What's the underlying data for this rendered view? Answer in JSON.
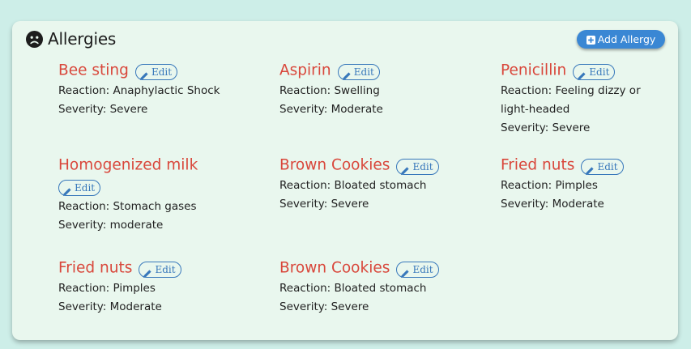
{
  "header": {
    "title": "Allergies",
    "add_label": "Add Allergy"
  },
  "edit_label": "Edit",
  "items": [
    {
      "name": "Bee sting",
      "reaction": "Reaction: Anaphylactic Shock",
      "severity": "Severity: Severe"
    },
    {
      "name": "Aspirin",
      "reaction": "Reaction: Swelling",
      "severity": "Severity: Moderate"
    },
    {
      "name": "Penicillin",
      "reaction": "Reaction: Feeling dizzy or light-headed",
      "severity": "Severity: Severe"
    },
    {
      "name": "Homogenized milk",
      "reaction": "Reaction: Stomach gases",
      "severity": "Severity: moderate"
    },
    {
      "name": "Brown Cookies",
      "reaction": "Reaction: Bloated stomach",
      "severity": "Severity: Severe"
    },
    {
      "name": "Fried nuts",
      "reaction": "Reaction: Pimples",
      "severity": "Severity: Moderate"
    },
    {
      "name": "Fried nuts",
      "reaction": "Reaction: Pimples",
      "severity": "Severity: Moderate"
    },
    {
      "name": "Brown Cookies",
      "reaction": "Reaction: Bloated stomach",
      "severity": "Severity: Severe"
    }
  ],
  "colors": {
    "background": "#cdeee8",
    "card": "#e9f7ee",
    "accent": "#3a87d4",
    "allergy_name": "#d9473b",
    "edit_outline": "#3878bb"
  },
  "icons": {
    "header": "frown-face-icon",
    "add": "plus-square-icon",
    "edit": "pencil-icon"
  }
}
